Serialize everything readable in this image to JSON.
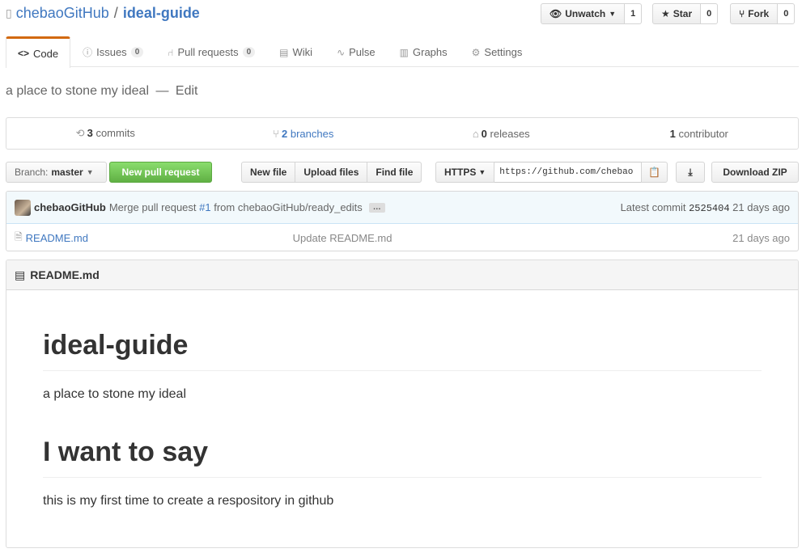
{
  "repo": {
    "owner": "chebaoGitHub",
    "separator": "/",
    "name": "ideal-guide",
    "description": "a place to stone my ideal",
    "description_separator": "—",
    "edit_label": "Edit"
  },
  "header_actions": {
    "watch_label": "Unwatch",
    "watch_count": "1",
    "star_label": "Star",
    "star_count": "0",
    "fork_label": "Fork",
    "fork_count": "0"
  },
  "tabs": [
    {
      "label": "Code",
      "icon": "code-icon",
      "active": true
    },
    {
      "label": "Issues",
      "icon": "issue-icon",
      "counter": "0"
    },
    {
      "label": "Pull requests",
      "icon": "pull-request-icon",
      "counter": "0"
    },
    {
      "label": "Wiki",
      "icon": "book-icon"
    },
    {
      "label": "Pulse",
      "icon": "pulse-icon"
    },
    {
      "label": "Graphs",
      "icon": "graph-icon"
    },
    {
      "label": "Settings",
      "icon": "gear-icon"
    }
  ],
  "summary": {
    "commits_count": "3",
    "commits_label": "commits",
    "branches_count": "2",
    "branches_label": "branches",
    "releases_count": "0",
    "releases_label": "releases",
    "contributors_count": "1",
    "contributors_label": "contributor"
  },
  "toolbar": {
    "branch_prefix": "Branch:",
    "branch_name": "master",
    "new_pr_label": "New pull request",
    "new_file_label": "New file",
    "upload_label": "Upload files",
    "find_file_label": "Find file",
    "protocol_label": "HTTPS",
    "clone_url": "https://github.com/chebao",
    "download_zip_label": "Download ZIP"
  },
  "latest_commit": {
    "author": "chebaoGitHub",
    "message_prefix": "Merge pull request",
    "pr_link": "#1",
    "message_suffix": "from chebaoGitHub/ready_edits",
    "ellipsis": "…",
    "latest_label": "Latest commit",
    "sha": "2525404",
    "age": "21 days ago"
  },
  "files": [
    {
      "name": "README.md",
      "message": "Update README.md",
      "age": "21 days ago"
    }
  ],
  "readme": {
    "filename": "README.md",
    "h1_1": "ideal-guide",
    "p_1": "a place to stone my ideal",
    "h1_2": "I want to say",
    "p_2": "this is my first time to create a respository in github"
  },
  "colors": {
    "link": "#4078c0",
    "active_tab": "#d26911",
    "primary_button": "#60b044",
    "commit_bar": "#f2f9fc"
  }
}
